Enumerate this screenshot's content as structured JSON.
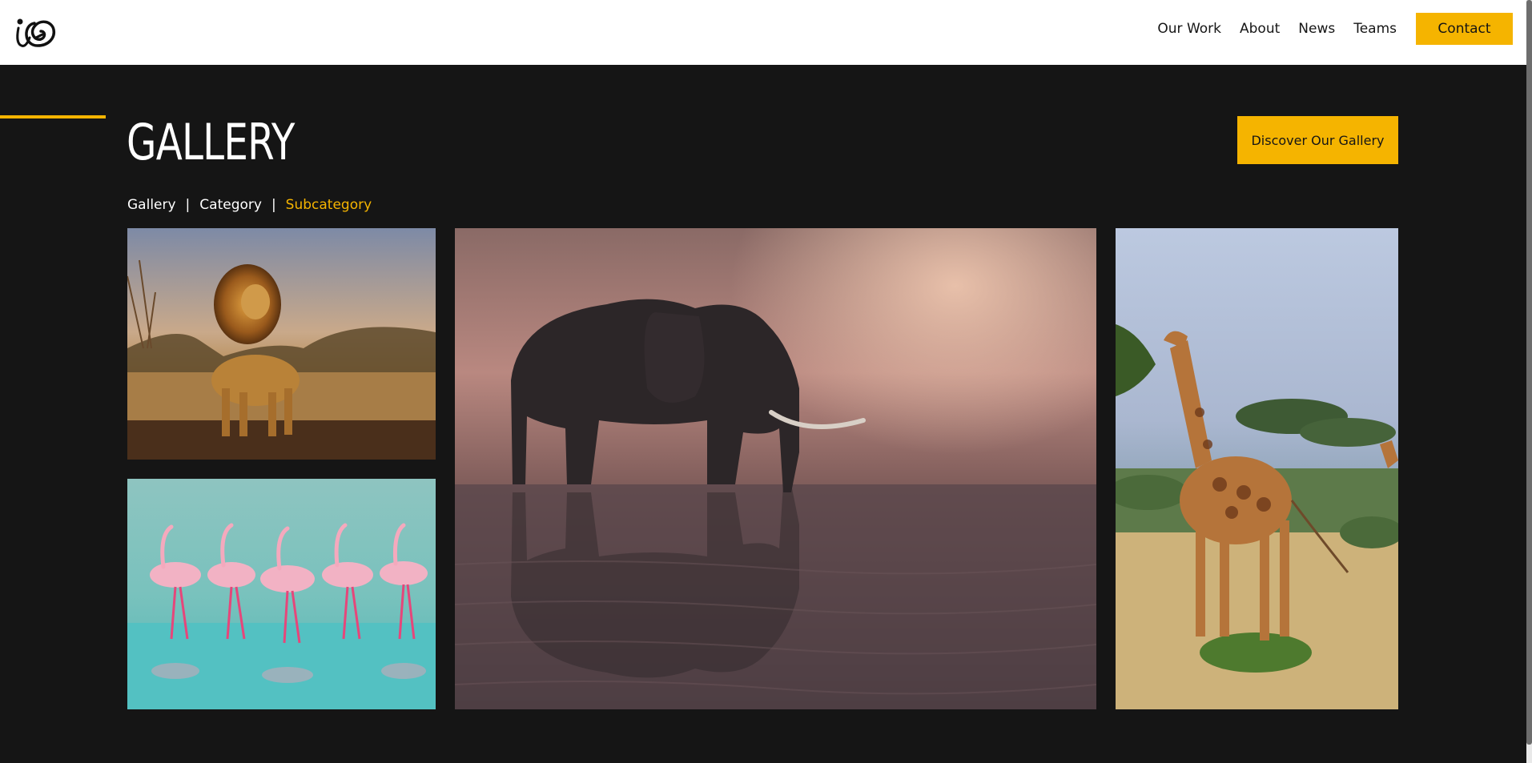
{
  "header": {
    "logo_alt": "logo",
    "nav": [
      {
        "label": "Our Work"
      },
      {
        "label": "About"
      },
      {
        "label": "News"
      },
      {
        "label": "Teams"
      }
    ],
    "contact_label": "Contact"
  },
  "gallery": {
    "title": "GALLERY",
    "discover_label": "Discover Our Gallery",
    "breadcrumb": {
      "item1": "Gallery",
      "sep": "|",
      "item2": "Category",
      "current": "Subcategory"
    },
    "photos": [
      "lion",
      "flamingos",
      "elephant",
      "giraffe"
    ]
  },
  "colors": {
    "accent": "#f5b400",
    "background": "#151515",
    "header": "#ffffff"
  }
}
